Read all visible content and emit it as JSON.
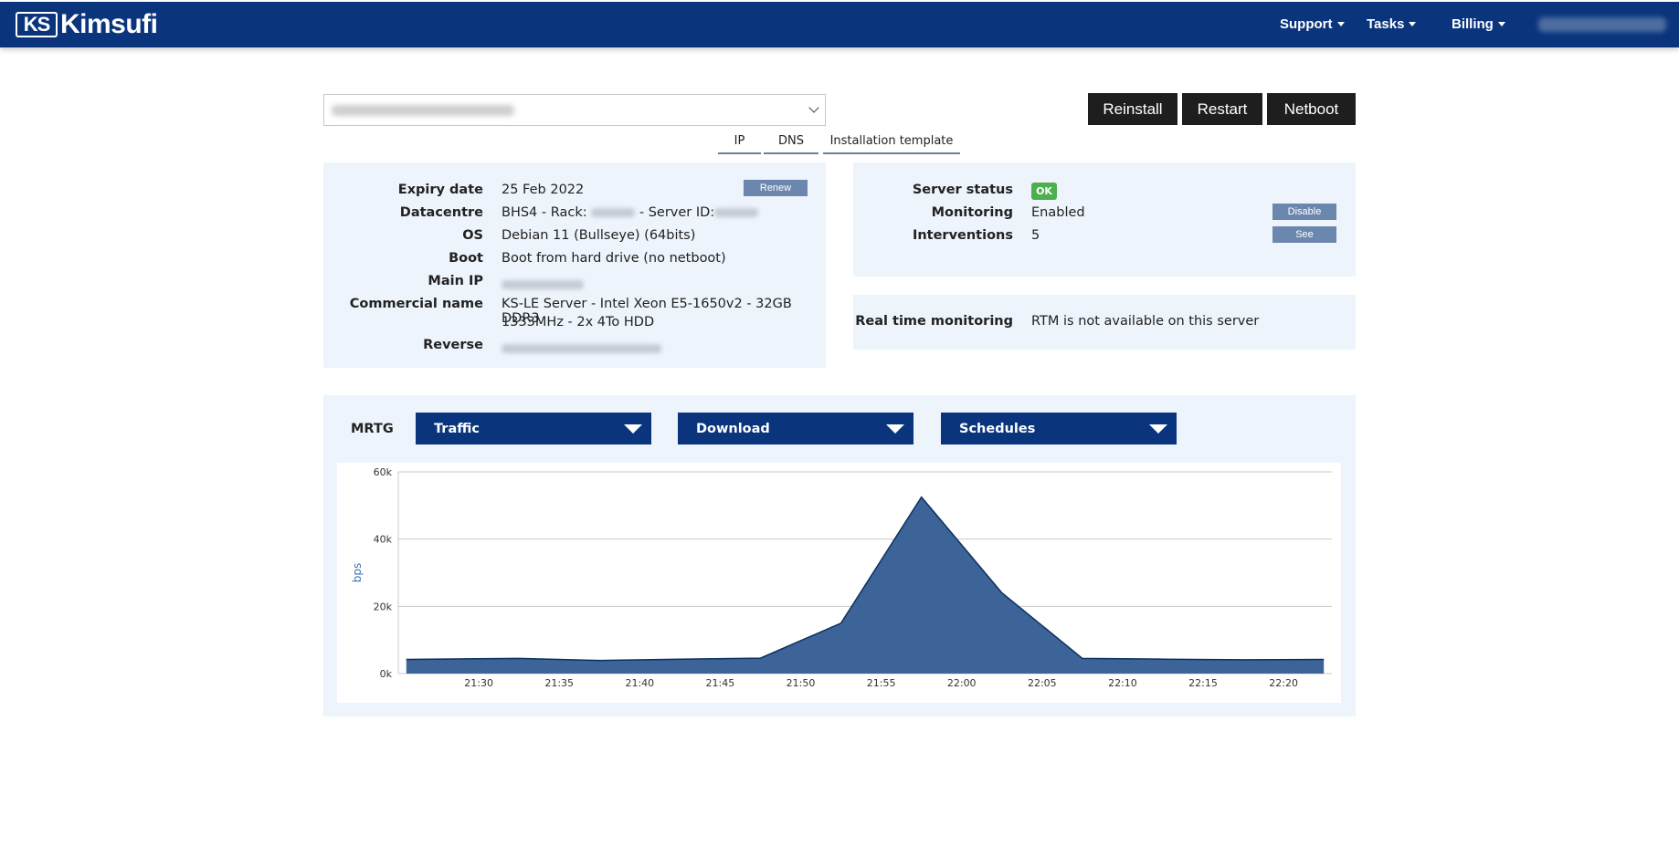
{
  "header": {
    "logo_badge": "KS",
    "logo_text": "Kimsufi",
    "nav": [
      {
        "label": "Support"
      },
      {
        "label": "Tasks"
      },
      {
        "label": "Billing"
      }
    ]
  },
  "actions": {
    "reinstall": "Reinstall",
    "restart": "Restart",
    "netboot": "Netboot"
  },
  "tabs": [
    "IP",
    "DNS",
    "Installation template"
  ],
  "server_info": {
    "expiry_label": "Expiry date",
    "expiry_value": "25 Feb 2022",
    "renew": "Renew",
    "datacentre_label": "Datacentre",
    "datacentre_prefix": "BHS4 - Rack:",
    "datacentre_mid": "- Server ID:",
    "os_label": "OS",
    "os_value": "Debian 11 (Bullseye) (64bits)",
    "boot_label": "Boot",
    "boot_value": "Boot from hard drive (no netboot)",
    "main_ip_label": "Main IP",
    "commercial_label": "Commercial name",
    "commercial_line1": "KS-LE Server - Intel Xeon E5-1650v2 - 32GB DDR3",
    "commercial_line2": "1333MHz - 2x 4To HDD",
    "reverse_label": "Reverse"
  },
  "status": {
    "server_status_label": "Server status",
    "server_status_value": "OK",
    "monitoring_label": "Monitoring",
    "monitoring_value": "Enabled",
    "disable": "Disable",
    "interventions_label": "Interventions",
    "interventions_value": "5",
    "see": "See"
  },
  "rtm": {
    "label": "Real time monitoring",
    "value": "RTM is not available on this server"
  },
  "mrtg": {
    "label": "MRTG",
    "type_select": "Traffic",
    "direction_select": "Download",
    "period_select": "Schedules"
  },
  "colors": {
    "brand": "#0a357d",
    "panel": "#eef4fc",
    "area_fill": "#3c6499",
    "area_line": "#0e2f5e",
    "ok": "#4caf50"
  },
  "chart_data": {
    "type": "area",
    "ylabel": "bps",
    "ylim": [
      0,
      60000
    ],
    "yticks": [
      0,
      20000,
      40000,
      60000
    ],
    "ytick_labels": [
      "0k",
      "20k",
      "40k",
      "60k"
    ],
    "x_ticks": [
      "21:30",
      "21:35",
      "21:40",
      "21:45",
      "21:50",
      "21:55",
      "22:00",
      "22:05",
      "22:10",
      "22:15",
      "22:20"
    ],
    "x_minutes": [
      1285.5,
      1292.5,
      1297.5,
      1302.5,
      1307.5,
      1312.5,
      1317.5,
      1322.5,
      1327.5,
      1332.5,
      1337.5,
      1342.5
    ],
    "x_range_minutes": [
      1285,
      1343
    ],
    "x_tick_minutes": [
      1290,
      1295,
      1300,
      1305,
      1310,
      1315,
      1320,
      1325,
      1330,
      1335,
      1340
    ],
    "values": [
      4200,
      4500,
      3900,
      4300,
      4600,
      15000,
      52500,
      24000,
      4500,
      4300,
      4100,
      4200
    ],
    "grid": true
  }
}
